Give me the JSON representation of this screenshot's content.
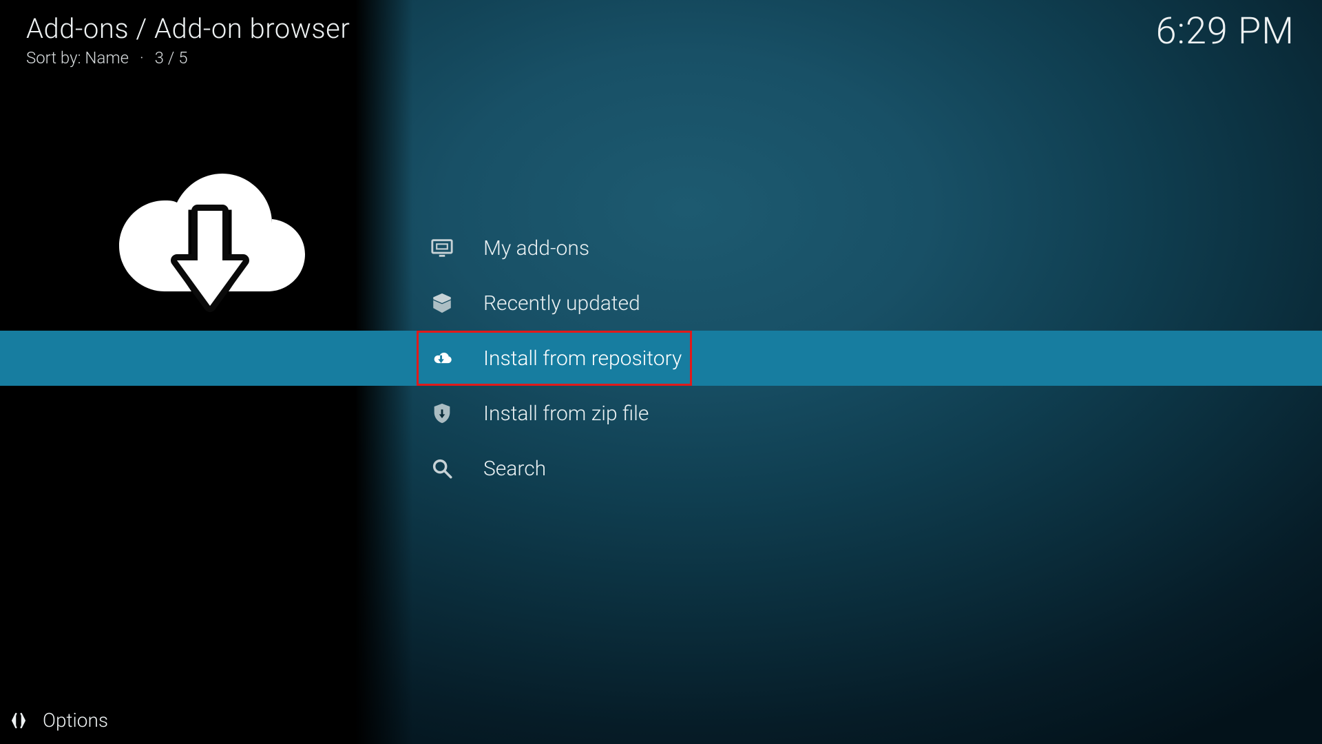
{
  "header": {
    "breadcrumb": "Add-ons / Add-on browser",
    "sort_prefix": "Sort by:",
    "sort_value": "Name",
    "position": "3 / 5",
    "clock": "6:29 PM"
  },
  "sidebar": {
    "section_icon": "cloud-download-icon"
  },
  "menu": {
    "items": [
      {
        "icon": "monitor-icon",
        "label": "My add-ons",
        "selected": false
      },
      {
        "icon": "open-box-icon",
        "label": "Recently updated",
        "selected": false
      },
      {
        "icon": "cloud-download-icon",
        "label": "Install from repository",
        "selected": true
      },
      {
        "icon": "shield-download-icon",
        "label": "Install from zip file",
        "selected": false
      },
      {
        "icon": "search-icon",
        "label": "Search",
        "selected": false
      }
    ]
  },
  "footer": {
    "options_label": "Options"
  },
  "annotation": {
    "highlight": "Install from repository"
  }
}
